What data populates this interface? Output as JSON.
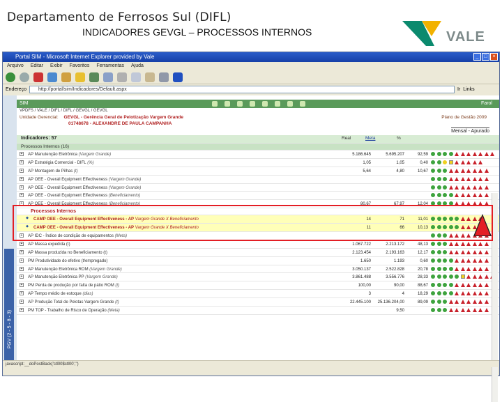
{
  "slide": {
    "title": "Departamento de Ferrosos Sul (DIFL)",
    "subtitle": "INDICADORES GEVGL – PROCESSOS INTERNOS",
    "logo_text": "VALE"
  },
  "browser": {
    "title": "Portal SIM - Microsoft Internet Explorer provided by Vale",
    "menu": [
      "Arquivo",
      "Editar",
      "Exibir",
      "Favoritos",
      "Ferramentas",
      "Ajuda"
    ],
    "address_label": "Endereço",
    "address_value": "http://portal/sim/Indicadores/Default.aspx",
    "go_label": "Ir",
    "links_label": "Links",
    "status_text": "javascript:__doPostBack('ctl00$ctl00','')"
  },
  "app": {
    "header_label": "SIM",
    "farol_label": "Farol",
    "breadcrumb": "VPDFS / VALE / DIFL / DIFL / GEVGL / GEVGL",
    "unidade_label": "Unidade Gerencial:",
    "unidade_value": "GEVGL - Gerência Geral de Pelotização Vargem Grande",
    "responsavel_value": "01748678 - ALEXANDRE DE PAULA CAMPANHA",
    "plano_label": "Plano de Gestão 2009",
    "mensal_label": "Mensal - Apurado",
    "vertical_label": "PGV (2 - 5 - 8 - 3)"
  },
  "table": {
    "title": "Indicadores: 57",
    "col_real": "Real",
    "col_meta": "Meta",
    "col_pct": "%",
    "group_label": "Processos Internos (16)",
    "subgroup_label": "Processos Internos",
    "rows": [
      {
        "name": "AP Manutenção Eletrônica",
        "sub": "(Vargem Grande)",
        "real": "5.186.645",
        "meta": "5.695.207",
        "pct": "92,59",
        "lights": "ggggttttttt"
      },
      {
        "name": "AP Estratégia Comercial - DIFL",
        "sub": "(%)",
        "real": "1,05",
        "meta": "1,05",
        "pct": "0,40",
        "lights": "ggysttttt"
      },
      {
        "name": "AP Montagem de Pilhas",
        "sub": "(t)",
        "real": "5,64",
        "meta": "4,80",
        "pct": "10,67",
        "lights": "gggttttttt"
      },
      {
        "name": "AP OEE - Overall Equipment Effectiveness",
        "sub": "(Vargem Grande)",
        "real": "",
        "meta": "",
        "pct": "",
        "lights": "gggttttttt"
      },
      {
        "name": "AP OEE - Overall Equipment Effectiveness",
        "sub": "(Vargem Grande)",
        "real": "",
        "meta": "",
        "pct": "",
        "lights": "gggttttttt"
      },
      {
        "name": "AP OEE - Overall Equipment Effectiveness",
        "sub": "(Beneficiamento)",
        "real": "",
        "meta": "",
        "pct": "",
        "lights": "ggggtttttt"
      },
      {
        "name": "AP OEE - Overall Equipment Effectiveness",
        "sub": "(Beneficiamento)",
        "real": "80,67",
        "meta": "67,97",
        "pct": "12,04",
        "lights": "ggggtttttt"
      }
    ],
    "highlight_rows": [
      {
        "name": "CAMP OEE - Overall Equipment Effectiveness - AP",
        "sub": "Vargem Grande X Beneficiamento",
        "real": "14",
        "meta": "71",
        "pct": "11,01",
        "lights": "gggggtttt"
      },
      {
        "name": "CAMP OEE - Overall Equipment Effectiveness - AP",
        "sub": "Vargem Grande X Beneficiamento",
        "real": "11",
        "meta": "66",
        "pct": "10,13",
        "lights": "gggggtttt"
      }
    ],
    "rows_after": [
      {
        "name": "AP IDC - Índice de condição de equipamentos",
        "sub": "(Meta)",
        "real": "",
        "meta": "",
        "pct": "",
        "lights": "gggttttttt"
      },
      {
        "name": "AP Massa expedida (t)",
        "sub": "",
        "real": "1.067.722",
        "meta": "2.213.172",
        "pct": "48,13",
        "lights": "gggttttttt"
      },
      {
        "name": "AP Massa produzida no Beneficiamento (t)",
        "sub": "",
        "real": "2.123.454",
        "meta": "2.193.163",
        "pct": "12,17",
        "lights": "gggttttttt"
      },
      {
        "name": "PM Produtividade do efetivo (t/empregado)",
        "sub": "",
        "real": "1.650",
        "meta": "1.193",
        "pct": "0,60",
        "lights": "ggggtttttt"
      },
      {
        "name": "AP Manutenção Eletrônica ROM",
        "sub": "(Vargem Grande)",
        "real": "3.050.137",
        "meta": "2.522.828",
        "pct": "20,78",
        "lights": "ggggtttttt"
      },
      {
        "name": "AP Manutenção Eletrônica PP",
        "sub": "(Vargem Grande)",
        "real": "3.861.488",
        "meta": "3.556.776",
        "pct": "28,33",
        "lights": "gggggsttttt"
      },
      {
        "name": "PM Perda de produção por falta de pátio ROM",
        "sub": "(t)",
        "real": "100,00",
        "meta": "90,00",
        "pct": "88,67",
        "lights": "ggggtttttt"
      },
      {
        "name": "AP Tempo médio de estoque",
        "sub": "(dias)",
        "real": "3",
        "meta": "4",
        "pct": "18,29",
        "lights": "ggggtttttt"
      },
      {
        "name": "AP Produção Total de Pelotas Vargem Grande",
        "sub": "(t)",
        "real": "22.445.100",
        "meta": "25.136.204,00",
        "pct": "89,09",
        "lights": "gggttttttt"
      },
      {
        "name": "PM TOP - Trabalho de Risco de Operação",
        "sub": "(Meta)",
        "real": "",
        "meta": "9,50",
        "pct": "",
        "lights": "gggttttttt"
      }
    ]
  },
  "colors": {
    "green_light": "#3da33d",
    "red_triangle": "#c8202a",
    "yellow": "#f0d020",
    "highlight_frame": "#e31e24",
    "vale_green": "#0b8a6e",
    "vale_yellow": "#f2b200"
  }
}
